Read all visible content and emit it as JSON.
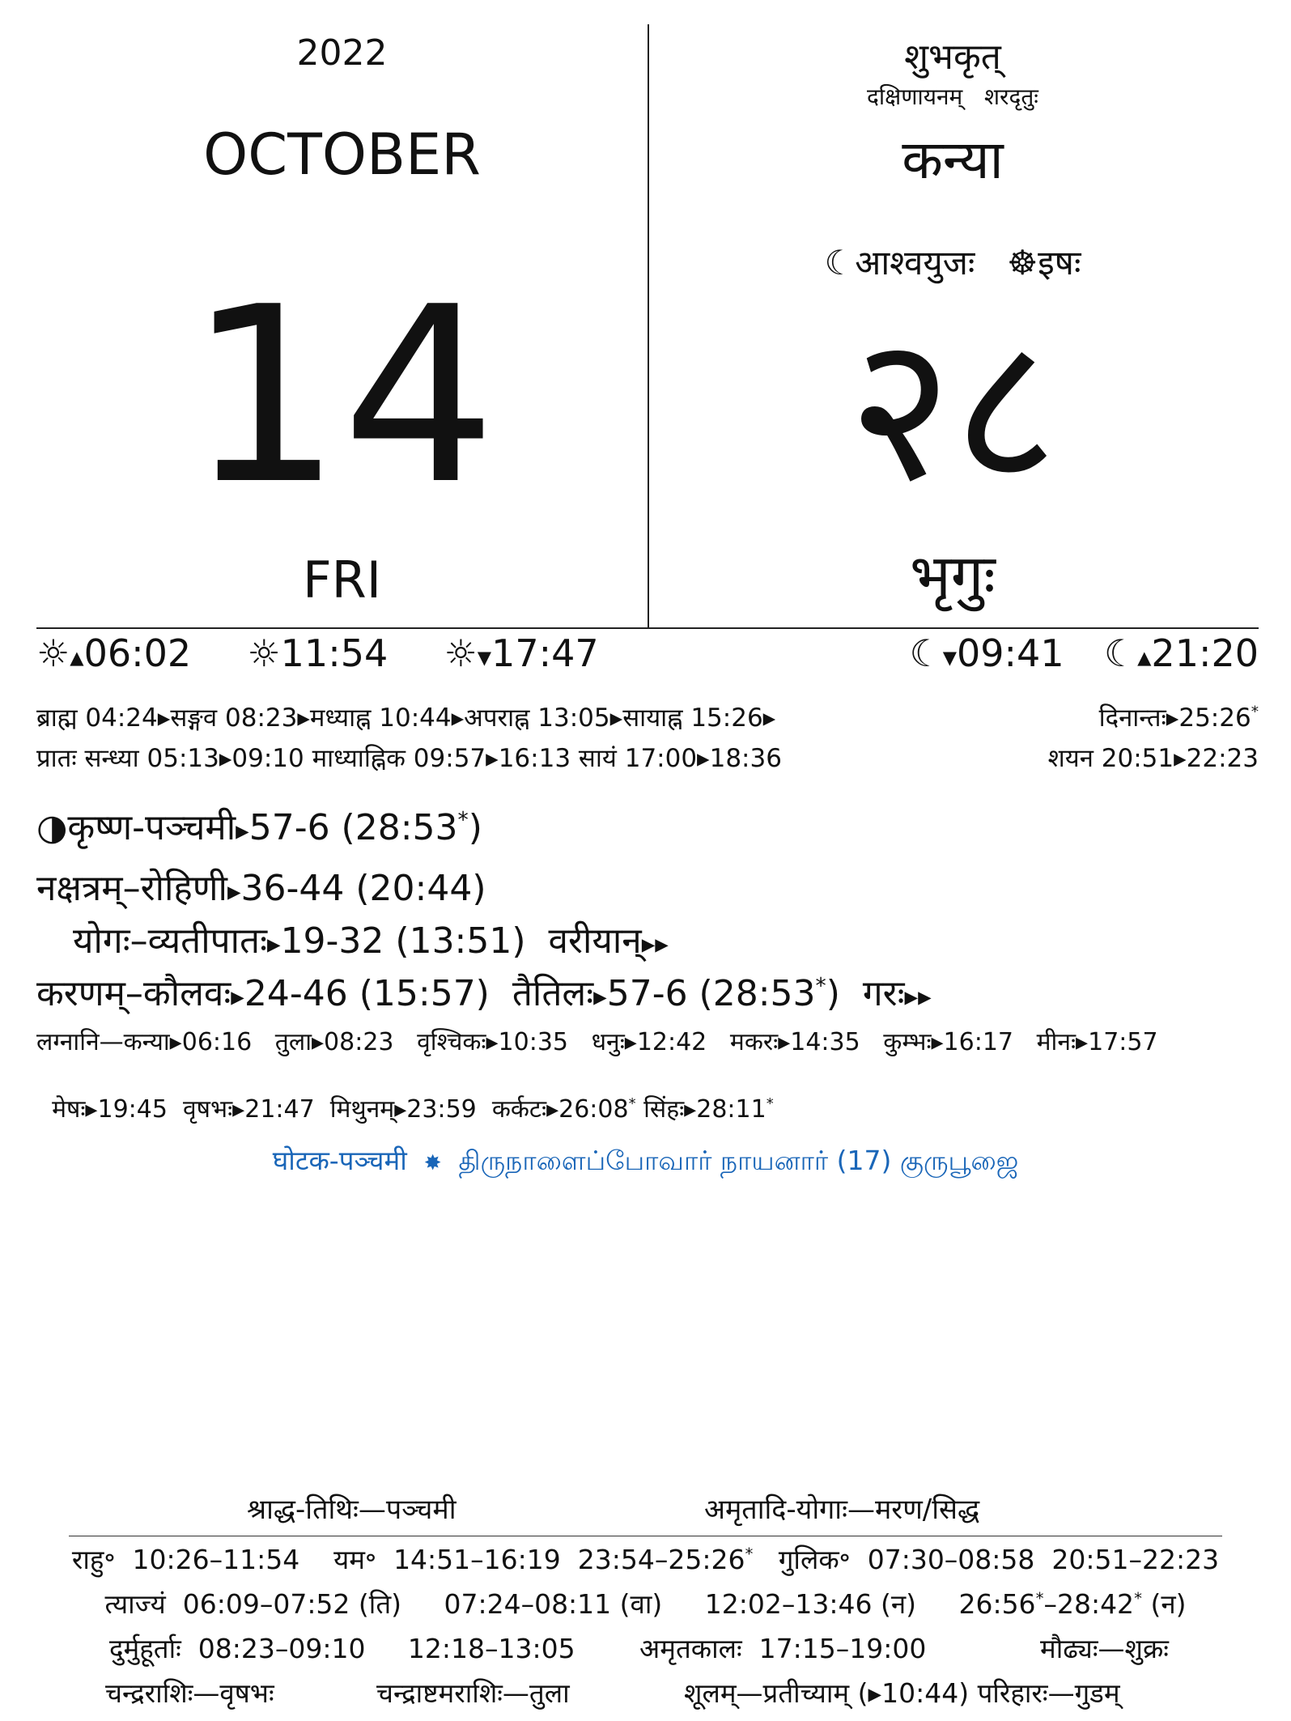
{
  "header": {
    "year": "2022",
    "month": "OCTOBER",
    "day": "14",
    "weekday": "FRI",
    "samvatsara": "शुभकृत्",
    "ayana": "दक्षिणायनम्",
    "ritu": "शरदृतुः",
    "rashi": "कन्या",
    "lunar_month": "आश्वयुजः",
    "solar_month": "इषः",
    "solar_day": "२८",
    "vara": "भृगुः"
  },
  "sun_moon": {
    "sunrise": "06:02",
    "noon": "11:54",
    "sunset": "17:47",
    "moonset": "09:41",
    "moonrise": "21:20"
  },
  "muhurta": {
    "brahma": "ब्राह्म 04:24",
    "sangava": "सङ्गव 08:23",
    "madhyahna": "मध्याह्न 10:44",
    "aparahna": "अपराह्न 13:05",
    "sayahna": "सायाह्न 15:26",
    "dinanta_label": "दिनान्तः",
    "dinanta_time": "25:26",
    "sandhya": "प्रातः सन्ध्या 05:13▸09:10 माध्याह्निक 09:57▸16:13 सायं 17:00▸18:36",
    "shayana": "शयन 20:51▸22:23"
  },
  "panchanga": {
    "tithi": "कृष्ण-पञ्चमी",
    "tithi_val": "57-6 (28:53",
    "nakshatra": "नक्षत्रम्–रोहिणी",
    "nakshatra_val": "36-44 (20:44)",
    "yoga": "योगः–व्यतीपातः",
    "yoga_val": "19-32 (13:51)",
    "yoga_next": "वरीयान्",
    "karana": "करणम्–कौलवः",
    "karana_val": "24-46 (15:57)",
    "karana2": "तैतिलः",
    "karana2_val": "57-6 (28:53",
    "karana_next": "गरः"
  },
  "lagnas": {
    "line1": "लग्नानि—कन्या▸06:16   तुला▸08:23   वृश्चिकः▸10:35   धनुः▸12:42   मकरः▸14:35   कुम्भः▸16:17   मीनः▸17:57",
    "line2": "मेषः▸19:45  वृषभः▸21:47  मिथुनम्▸23:59  कर्कटः▸26:08",
    "line2_end": "सिंहः▸28:11"
  },
  "festival": {
    "sanskrit": "घोटक-पञ्चमी",
    "tamil": "திருநாளைப்போவார் நாயனார் (17) குருபூஜை"
  },
  "footer": {
    "shraddha": "श्राद्ध-तिथिः—पञ्चमी",
    "amritadi": "अमृतादि-योगाः—मरण/सिद्ध",
    "rahu": "राहु॰  10:26–11:54    यम॰  14:51–16:19  23:54–25:26",
    "gulika": "गुलिक॰  07:30–08:58  20:51–22:23",
    "tyajya": "त्याज्यं  06:09–07:52 (ति)     07:24–08:11 (वा)     12:02–13:46 (न)     26:56",
    "tyajya_end": "–28:42",
    "tyajya_tail": " (न)",
    "durmuhurta": "दुर्मुहूर्ताः  08:23–09:10     12:18–13:05",
    "amritakala": "अमृतकालः  17:15–19:00",
    "maudhya": "मौढ्यः—शुक्रः",
    "chandra_rashi": "चन्द्रराशिः—वृषभः",
    "chandrashtama": "चन्द्राष्टमराशिः—तुला",
    "shula": "शूलम्—प्रतीच्याम् (▸10:44) परिहारः—गुडम्"
  }
}
